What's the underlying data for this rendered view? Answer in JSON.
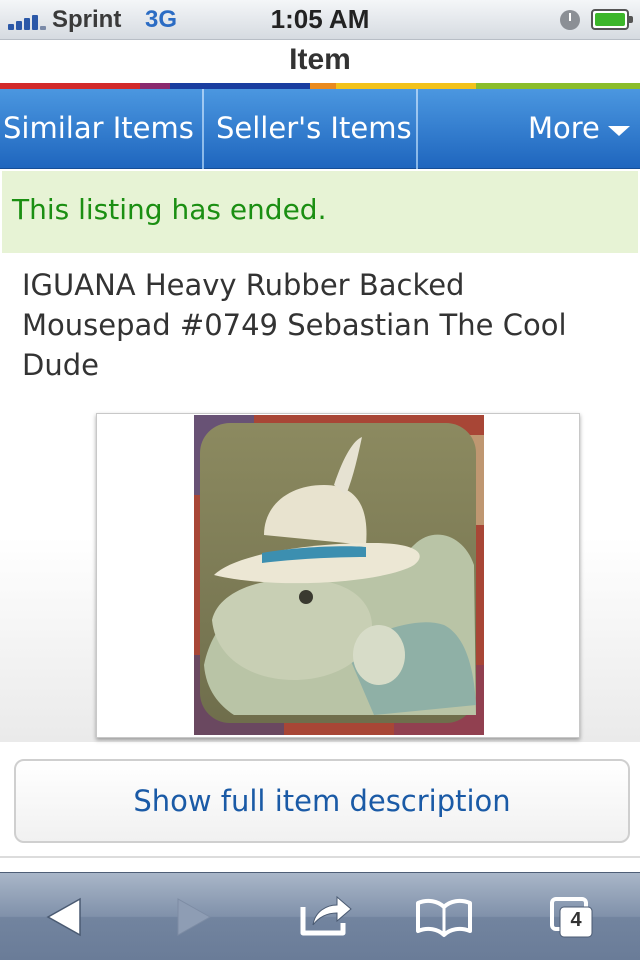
{
  "status_bar": {
    "carrier": "Sprint",
    "network": "3G",
    "time": "1:05 AM"
  },
  "nav": {
    "title": "Item"
  },
  "tabs": {
    "similar": "Similar Items",
    "seller": "Seller's Items",
    "more": "More"
  },
  "notice": "This listing has ended.",
  "item": {
    "title": "IGUANA Heavy Rubber Backed Mousepad #0749 Sebastian The Cool Dude"
  },
  "actions": {
    "show_description": "Show full item description"
  },
  "toolbar": {
    "back_icon": "back-arrow-icon",
    "forward_icon": "forward-arrow-icon",
    "share_icon": "share-icon",
    "bookmarks_icon": "bookmarks-icon",
    "tabs_icon": "tabs-icon",
    "tab_count": "4"
  },
  "colors": {
    "tab_blue": "#2f7ad0",
    "ended_green": "#1b8f12",
    "ended_bg": "#e7f3d5",
    "link_blue": "#1a5aa6",
    "stripe": [
      "#d22a2a",
      "#1a3ea0",
      "#e98a1e",
      "#f2c21b",
      "#8bbd2a"
    ]
  }
}
